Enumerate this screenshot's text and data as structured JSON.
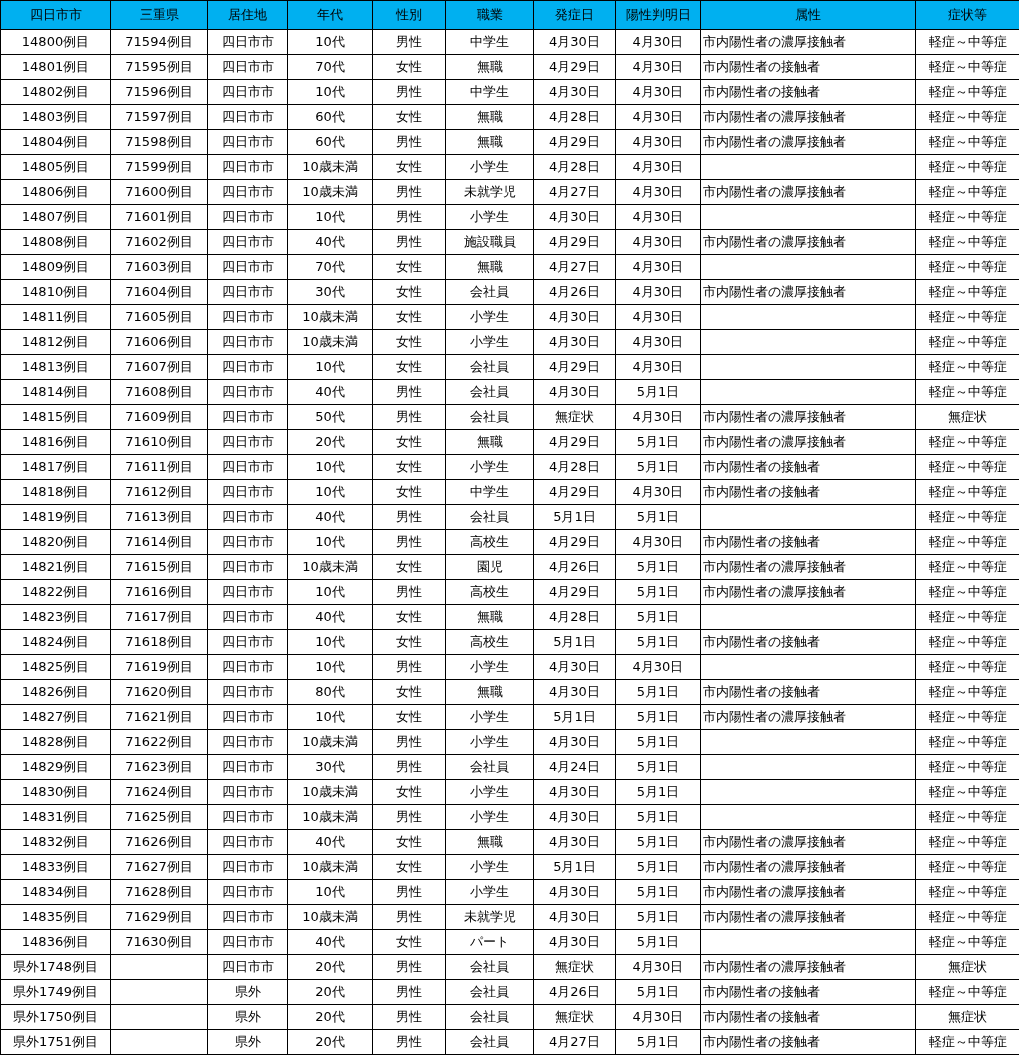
{
  "table": {
    "columns": [
      {
        "label": "四日市市"
      },
      {
        "label": "三重県"
      },
      {
        "label": "居住地"
      },
      {
        "label": "年代"
      },
      {
        "label": "性別"
      },
      {
        "label": "職業"
      },
      {
        "label": "発症日"
      },
      {
        "label": "陽性判明日"
      },
      {
        "label": "属性"
      },
      {
        "label": "症状等"
      }
    ],
    "rows": [
      {
        "case": "14800例目",
        "mie": "71594例目",
        "residence": "四日市市",
        "age": "10代",
        "sex": "男性",
        "job": "中学生",
        "onset": "4月30日",
        "positive": "4月30日",
        "attribute": "市内陽性者の濃厚接触者",
        "symptom": "軽症～中等症"
      },
      {
        "case": "14801例目",
        "mie": "71595例目",
        "residence": "四日市市",
        "age": "70代",
        "sex": "女性",
        "job": "無職",
        "onset": "4月29日",
        "positive": "4月30日",
        "attribute": "市内陽性者の接触者",
        "symptom": "軽症～中等症"
      },
      {
        "case": "14802例目",
        "mie": "71596例目",
        "residence": "四日市市",
        "age": "10代",
        "sex": "男性",
        "job": "中学生",
        "onset": "4月30日",
        "positive": "4月30日",
        "attribute": "市内陽性者の接触者",
        "symptom": "軽症～中等症"
      },
      {
        "case": "14803例目",
        "mie": "71597例目",
        "residence": "四日市市",
        "age": "60代",
        "sex": "女性",
        "job": "無職",
        "onset": "4月28日",
        "positive": "4月30日",
        "attribute": "市内陽性者の濃厚接触者",
        "symptom": "軽症～中等症"
      },
      {
        "case": "14804例目",
        "mie": "71598例目",
        "residence": "四日市市",
        "age": "60代",
        "sex": "男性",
        "job": "無職",
        "onset": "4月29日",
        "positive": "4月30日",
        "attribute": "市内陽性者の濃厚接触者",
        "symptom": "軽症～中等症"
      },
      {
        "case": "14805例目",
        "mie": "71599例目",
        "residence": "四日市市",
        "age": "10歳未満",
        "sex": "女性",
        "job": "小学生",
        "onset": "4月28日",
        "positive": "4月30日",
        "symptom": "軽症～中等症"
      },
      {
        "case": "14806例目",
        "mie": "71600例目",
        "residence": "四日市市",
        "age": "10歳未満",
        "sex": "男性",
        "job": "未就学児",
        "onset": "4月27日",
        "positive": "4月30日",
        "attribute": "市内陽性者の濃厚接触者",
        "symptom": "軽症～中等症"
      },
      {
        "case": "14807例目",
        "mie": "71601例目",
        "residence": "四日市市",
        "age": "10代",
        "sex": "男性",
        "job": "小学生",
        "onset": "4月30日",
        "positive": "4月30日",
        "symptom": "軽症～中等症"
      },
      {
        "case": "14808例目",
        "mie": "71602例目",
        "residence": "四日市市",
        "age": "40代",
        "sex": "男性",
        "job": "施設職員",
        "onset": "4月29日",
        "positive": "4月30日",
        "attribute": "市内陽性者の濃厚接触者",
        "symptom": "軽症～中等症"
      },
      {
        "case": "14809例目",
        "mie": "71603例目",
        "residence": "四日市市",
        "age": "70代",
        "sex": "女性",
        "job": "無職",
        "onset": "4月27日",
        "positive": "4月30日",
        "symptom": "軽症～中等症"
      },
      {
        "case": "14810例目",
        "mie": "71604例目",
        "residence": "四日市市",
        "age": "30代",
        "sex": "女性",
        "job": "会社員",
        "onset": "4月26日",
        "positive": "4月30日",
        "attribute": "市内陽性者の濃厚接触者",
        "symptom": "軽症～中等症"
      },
      {
        "case": "14811例目",
        "mie": "71605例目",
        "residence": "四日市市",
        "age": "10歳未満",
        "sex": "女性",
        "job": "小学生",
        "onset": "4月30日",
        "positive": "4月30日",
        "symptom": "軽症～中等症"
      },
      {
        "case": "14812例目",
        "mie": "71606例目",
        "residence": "四日市市",
        "age": "10歳未満",
        "sex": "女性",
        "job": "小学生",
        "onset": "4月30日",
        "positive": "4月30日",
        "symptom": "軽症～中等症"
      },
      {
        "case": "14813例目",
        "mie": "71607例目",
        "residence": "四日市市",
        "age": "10代",
        "sex": "女性",
        "job": "会社員",
        "onset": "4月29日",
        "positive": "4月30日",
        "symptom": "軽症～中等症"
      },
      {
        "case": "14814例目",
        "mie": "71608例目",
        "residence": "四日市市",
        "age": "40代",
        "sex": "男性",
        "job": "会社員",
        "onset": "4月30日",
        "positive": "5月1日",
        "symptom": "軽症～中等症"
      },
      {
        "case": "14815例目",
        "mie": "71609例目",
        "residence": "四日市市",
        "age": "50代",
        "sex": "男性",
        "job": "会社員",
        "onset": "無症状",
        "positive": "4月30日",
        "attribute": "市内陽性者の濃厚接触者",
        "symptom": "無症状"
      },
      {
        "case": "14816例目",
        "mie": "71610例目",
        "residence": "四日市市",
        "age": "20代",
        "sex": "女性",
        "job": "無職",
        "onset": "4月29日",
        "positive": "5月1日",
        "attribute": "市内陽性者の濃厚接触者",
        "symptom": "軽症～中等症"
      },
      {
        "case": "14817例目",
        "mie": "71611例目",
        "residence": "四日市市",
        "age": "10代",
        "sex": "女性",
        "job": "小学生",
        "onset": "4月28日",
        "positive": "5月1日",
        "attribute": "市内陽性者の接触者",
        "symptom": "軽症～中等症"
      },
      {
        "case": "14818例目",
        "mie": "71612例目",
        "residence": "四日市市",
        "age": "10代",
        "sex": "女性",
        "job": "中学生",
        "onset": "4月29日",
        "positive": "4月30日",
        "attribute": "市内陽性者の接触者",
        "symptom": "軽症～中等症"
      },
      {
        "case": "14819例目",
        "mie": "71613例目",
        "residence": "四日市市",
        "age": "40代",
        "sex": "男性",
        "job": "会社員",
        "onset": "5月1日",
        "positive": "5月1日",
        "symptom": "軽症～中等症"
      },
      {
        "case": "14820例目",
        "mie": "71614例目",
        "residence": "四日市市",
        "age": "10代",
        "sex": "男性",
        "job": "高校生",
        "onset": "4月29日",
        "positive": "4月30日",
        "attribute": "市内陽性者の接触者",
        "symptom": "軽症～中等症"
      },
      {
        "case": "14821例目",
        "mie": "71615例目",
        "residence": "四日市市",
        "age": "10歳未満",
        "sex": "女性",
        "job": "園児",
        "onset": "4月26日",
        "positive": "5月1日",
        "attribute": "市内陽性者の濃厚接触者",
        "symptom": "軽症～中等症"
      },
      {
        "case": "14822例目",
        "mie": "71616例目",
        "residence": "四日市市",
        "age": "10代",
        "sex": "男性",
        "job": "高校生",
        "onset": "4月29日",
        "positive": "5月1日",
        "attribute": "市内陽性者の濃厚接触者",
        "symptom": "軽症～中等症"
      },
      {
        "case": "14823例目",
        "mie": "71617例目",
        "residence": "四日市市",
        "age": "40代",
        "sex": "女性",
        "job": "無職",
        "onset": "4月28日",
        "positive": "5月1日",
        "symptom": "軽症～中等症"
      },
      {
        "case": "14824例目",
        "mie": "71618例目",
        "residence": "四日市市",
        "age": "10代",
        "sex": "女性",
        "job": "高校生",
        "onset": "5月1日",
        "positive": "5月1日",
        "attribute": "市内陽性者の接触者",
        "symptom": "軽症～中等症"
      },
      {
        "case": "14825例目",
        "mie": "71619例目",
        "residence": "四日市市",
        "age": "10代",
        "sex": "男性",
        "job": "小学生",
        "onset": "4月30日",
        "positive": "4月30日",
        "symptom": "軽症～中等症"
      },
      {
        "case": "14826例目",
        "mie": "71620例目",
        "residence": "四日市市",
        "age": "80代",
        "sex": "女性",
        "job": "無職",
        "onset": "4月30日",
        "positive": "5月1日",
        "attribute": "市内陽性者の接触者",
        "symptom": "軽症～中等症"
      },
      {
        "case": "14827例目",
        "mie": "71621例目",
        "residence": "四日市市",
        "age": "10代",
        "sex": "女性",
        "job": "小学生",
        "onset": "5月1日",
        "positive": "5月1日",
        "attribute": "市内陽性者の濃厚接触者",
        "symptom": "軽症～中等症"
      },
      {
        "case": "14828例目",
        "mie": "71622例目",
        "residence": "四日市市",
        "age": "10歳未満",
        "sex": "男性",
        "job": "小学生",
        "onset": "4月30日",
        "positive": "5月1日",
        "symptom": "軽症～中等症"
      },
      {
        "case": "14829例目",
        "mie": "71623例目",
        "residence": "四日市市",
        "age": "30代",
        "sex": "男性",
        "job": "会社員",
        "onset": "4月24日",
        "positive": "5月1日",
        "symptom": "軽症～中等症"
      },
      {
        "case": "14830例目",
        "mie": "71624例目",
        "residence": "四日市市",
        "age": "10歳未満",
        "sex": "女性",
        "job": "小学生",
        "onset": "4月30日",
        "positive": "5月1日",
        "symptom": "軽症～中等症"
      },
      {
        "case": "14831例目",
        "mie": "71625例目",
        "residence": "四日市市",
        "age": "10歳未満",
        "sex": "男性",
        "job": "小学生",
        "onset": "4月30日",
        "positive": "5月1日",
        "symptom": "軽症～中等症"
      },
      {
        "case": "14832例目",
        "mie": "71626例目",
        "residence": "四日市市",
        "age": "40代",
        "sex": "女性",
        "job": "無職",
        "onset": "4月30日",
        "positive": "5月1日",
        "attribute": "市内陽性者の濃厚接触者",
        "symptom": "軽症～中等症"
      },
      {
        "case": "14833例目",
        "mie": "71627例目",
        "residence": "四日市市",
        "age": "10歳未満",
        "sex": "女性",
        "job": "小学生",
        "onset": "5月1日",
        "positive": "5月1日",
        "attribute": "市内陽性者の濃厚接触者",
        "symptom": "軽症～中等症"
      },
      {
        "case": "14834例目",
        "mie": "71628例目",
        "residence": "四日市市",
        "age": "10代",
        "sex": "男性",
        "job": "小学生",
        "onset": "4月30日",
        "positive": "5月1日",
        "attribute": "市内陽性者の濃厚接触者",
        "symptom": "軽症～中等症"
      },
      {
        "case": "14835例目",
        "mie": "71629例目",
        "residence": "四日市市",
        "age": "10歳未満",
        "sex": "男性",
        "job": "未就学児",
        "onset": "4月30日",
        "positive": "5月1日",
        "attribute": "市内陽性者の濃厚接触者",
        "symptom": "軽症～中等症"
      },
      {
        "case": "14836例目",
        "mie": "71630例目",
        "residence": "四日市市",
        "age": "40代",
        "sex": "女性",
        "job": "パート",
        "onset": "4月30日",
        "positive": "5月1日",
        "symptom": "軽症～中等症"
      },
      {
        "case": "県外1748例目",
        "residence": "四日市市",
        "age": "20代",
        "sex": "男性",
        "job": "会社員",
        "onset": "無症状",
        "positive": "4月30日",
        "attribute": "市内陽性者の濃厚接触者",
        "symptom": "無症状"
      },
      {
        "case": "県外1749例目",
        "residence": "県外",
        "age": "20代",
        "sex": "男性",
        "job": "会社員",
        "onset": "4月26日",
        "positive": "5月1日",
        "attribute": "市内陽性者の接触者",
        "symptom": "軽症～中等症"
      },
      {
        "case": "県外1750例目",
        "residence": "県外",
        "age": "20代",
        "sex": "男性",
        "job": "会社員",
        "onset": "無症状",
        "positive": "4月30日",
        "attribute": "市内陽性者の接触者",
        "symptom": "無症状"
      },
      {
        "case": "県外1751例目",
        "residence": "県外",
        "age": "20代",
        "sex": "男性",
        "job": "会社員",
        "onset": "4月27日",
        "positive": "5月1日",
        "attribute": "市内陽性者の接触者",
        "symptom": "軽症～中等症"
      }
    ]
  }
}
